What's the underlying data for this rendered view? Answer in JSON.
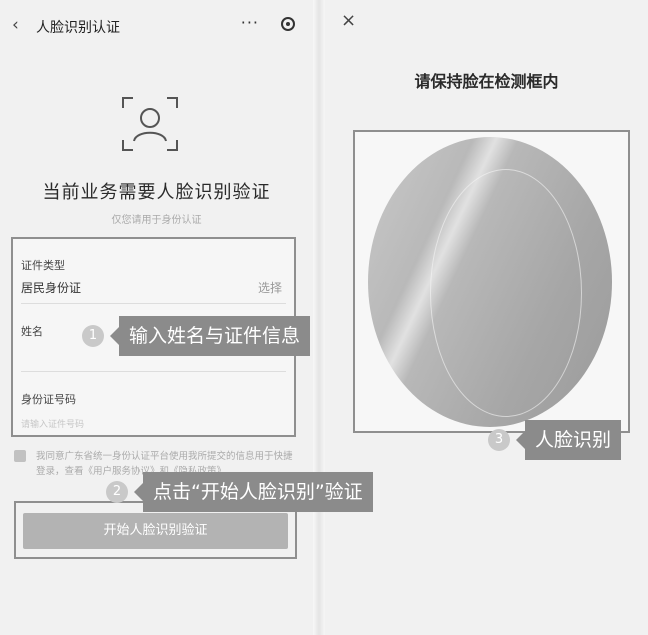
{
  "left": {
    "nav": {
      "back": "‹",
      "title": "人脸识别认证",
      "more": "···"
    },
    "headline": "当前业务需要人脸识别验证",
    "subline": "仅您请用于身份认证",
    "form": {
      "id_type_label": "证件类型",
      "id_type_value": "居民身份证",
      "id_type_action": "选择",
      "name_label": "姓名",
      "id_number_label": "身份证号码",
      "id_number_placeholder": "请输入证件号码"
    },
    "agreement": "我同意广东省统一身份认证平台使用我所提交的信息用于快捷登录，查看《用户服务协议》和《隐私政策》",
    "start_button": "开始人脸识别验证"
  },
  "callouts": [
    {
      "num": "1",
      "text": "输入姓名与证件信息"
    },
    {
      "num": "2",
      "text": "点击“开始人脸识别”验证"
    },
    {
      "num": "3",
      "text": "人脸识别"
    }
  ],
  "right": {
    "close": "×",
    "title": "请保持脸在检测框内"
  }
}
